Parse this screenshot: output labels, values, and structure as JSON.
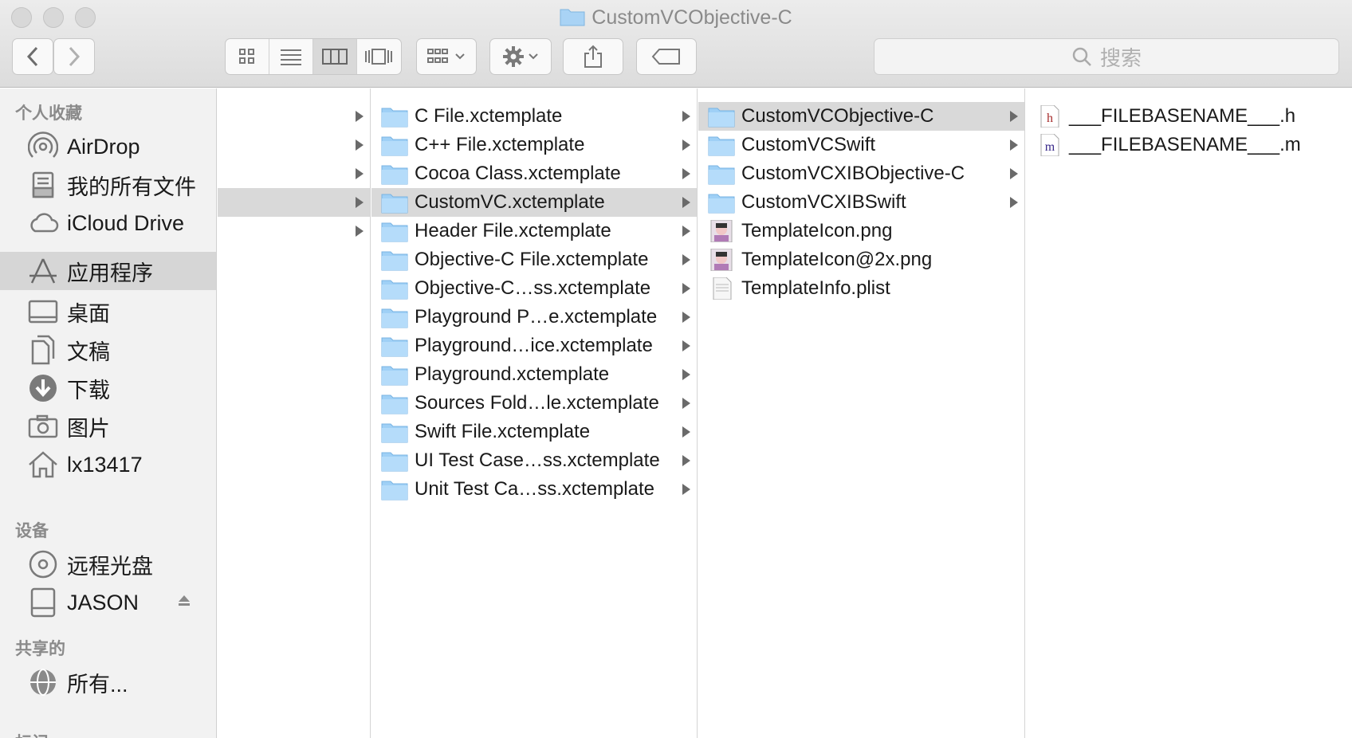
{
  "window": {
    "title": "CustomVCObjective-C"
  },
  "toolbar": {
    "search_placeholder": "搜索",
    "buttons": [
      "back-icon",
      "forward-icon",
      "icon-view",
      "list-view",
      "column-view",
      "cover-flow-view",
      "arrange-menu",
      "action-menu",
      "share",
      "tags"
    ]
  },
  "sidebar": {
    "sections": [
      {
        "header": "个人收藏",
        "items": [
          {
            "label": "AirDrop",
            "icon": "airdrop-icon"
          },
          {
            "label": "我的所有文件",
            "icon": "all-files-icon"
          },
          {
            "label": "iCloud Drive",
            "icon": "cloud-icon"
          },
          {
            "label": "应用程序",
            "icon": "applications-icon",
            "selected": true
          },
          {
            "label": "桌面",
            "icon": "desktop-icon"
          },
          {
            "label": "文稿",
            "icon": "documents-icon"
          },
          {
            "label": "下载",
            "icon": "downloads-icon"
          },
          {
            "label": "图片",
            "icon": "camera-icon"
          },
          {
            "label": "lx13417",
            "icon": "home-icon"
          }
        ]
      },
      {
        "header": "设备",
        "items": [
          {
            "label": "远程光盘",
            "icon": "disc-icon"
          },
          {
            "label": "JASON",
            "icon": "drive-icon",
            "eject": true
          }
        ]
      },
      {
        "header": "共享的",
        "items": [
          {
            "label": "所有...",
            "icon": "network-icon"
          }
        ]
      },
      {
        "header": "标记",
        "items": []
      }
    ]
  },
  "columns": {
    "col1": {
      "rows": [
        {
          "label": "",
          "arrow": true
        },
        {
          "label": "",
          "arrow": true
        },
        {
          "label": "",
          "arrow": true
        },
        {
          "label": "",
          "arrow": true,
          "selected": true
        },
        {
          "label": "",
          "arrow": true
        }
      ]
    },
    "col2": {
      "rows": [
        {
          "label": "C File.xctemplate",
          "arrow": true
        },
        {
          "label": "C++ File.xctemplate",
          "arrow": true
        },
        {
          "label": "Cocoa Class.xctemplate",
          "arrow": true
        },
        {
          "label": "CustomVC.xctemplate",
          "arrow": true,
          "selected": true
        },
        {
          "label": "Header File.xctemplate",
          "arrow": true
        },
        {
          "label": "Objective-C File.xctemplate",
          "arrow": true
        },
        {
          "label": "Objective-C…ss.xctemplate",
          "arrow": true
        },
        {
          "label": "Playground P…e.xctemplate",
          "arrow": true
        },
        {
          "label": "Playground…ice.xctemplate",
          "arrow": true
        },
        {
          "label": "Playground.xctemplate",
          "arrow": true
        },
        {
          "label": "Sources Fold…le.xctemplate",
          "arrow": true
        },
        {
          "label": "Swift File.xctemplate",
          "arrow": true
        },
        {
          "label": "UI Test Case…ss.xctemplate",
          "arrow": true
        },
        {
          "label": "Unit Test Ca…ss.xctemplate",
          "arrow": true
        }
      ]
    },
    "col3": {
      "rows": [
        {
          "label": "CustomVCObjective-C",
          "arrow": true,
          "selected": true,
          "kind": "folder"
        },
        {
          "label": "CustomVCSwift",
          "arrow": true,
          "kind": "folder"
        },
        {
          "label": "CustomVCXIBObjective-C",
          "arrow": true,
          "kind": "folder"
        },
        {
          "label": "CustomVCXIBSwift",
          "arrow": true,
          "kind": "folder"
        },
        {
          "label": "TemplateIcon.png",
          "arrow": false,
          "kind": "image"
        },
        {
          "label": "TemplateIcon@2x.png",
          "arrow": false,
          "kind": "image"
        },
        {
          "label": "TemplateInfo.plist",
          "arrow": false,
          "kind": "plist"
        }
      ]
    },
    "col4": {
      "rows": [
        {
          "label": "___FILEBASENAME___.h",
          "kind": "h-file",
          "badge": "h"
        },
        {
          "label": "___FILEBASENAME___.m",
          "kind": "m-file",
          "badge": "m"
        }
      ]
    }
  }
}
